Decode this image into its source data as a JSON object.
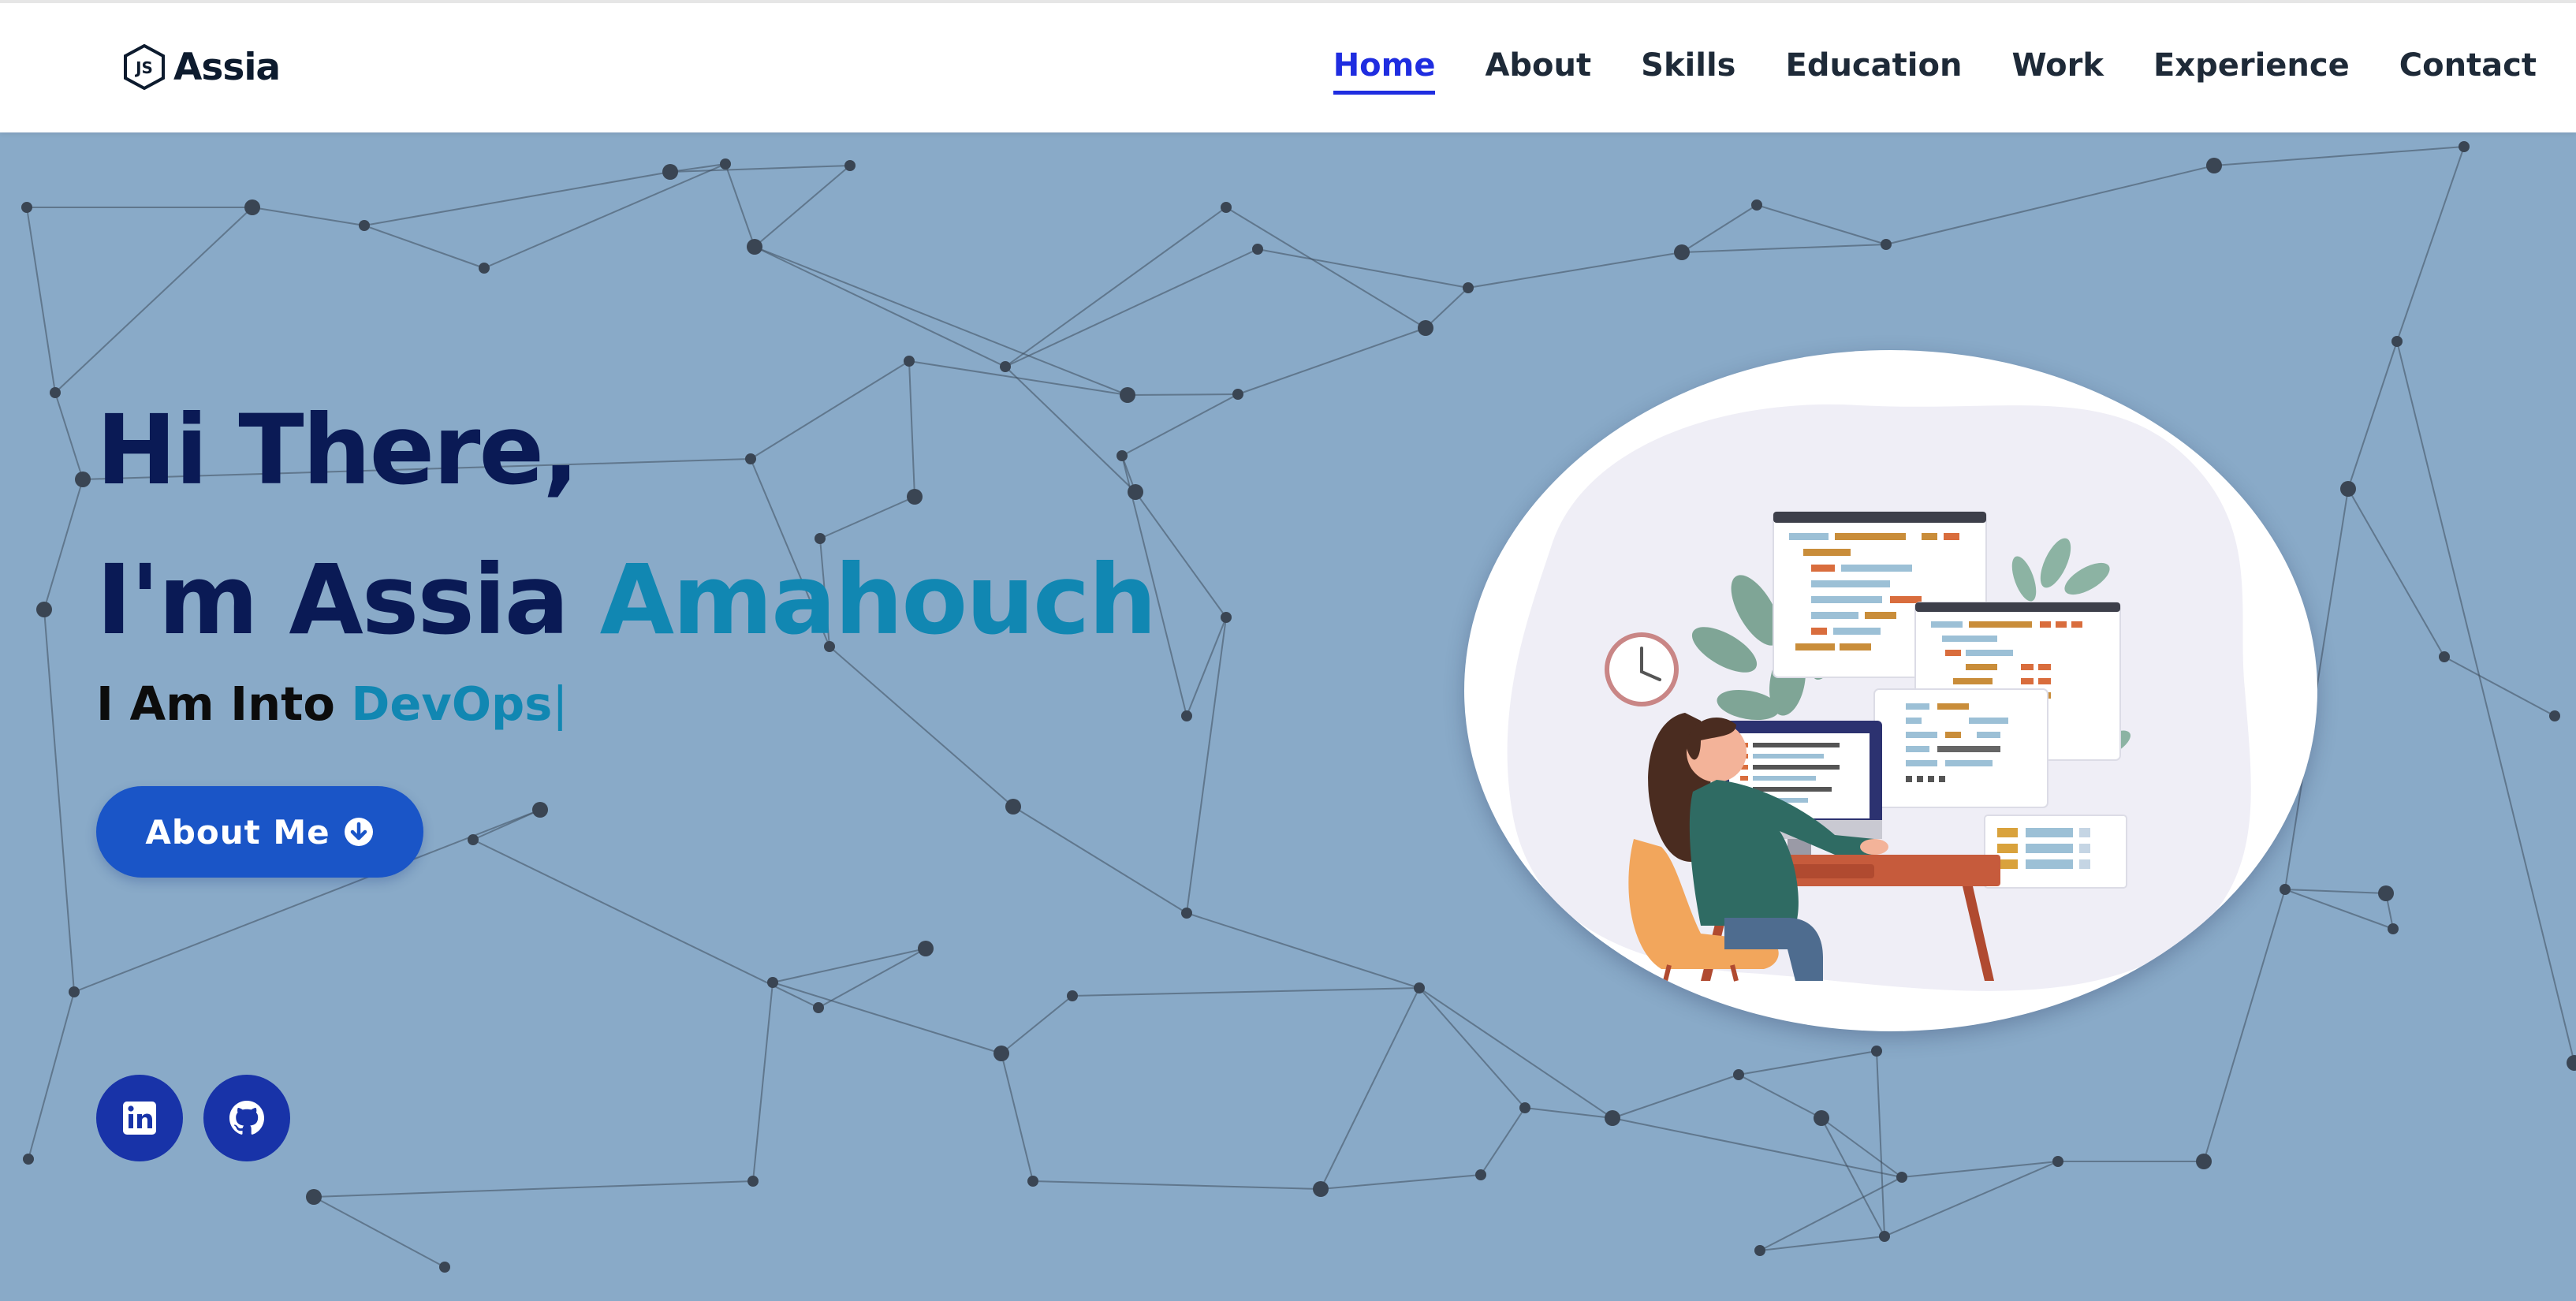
{
  "header": {
    "brand_icon": "nodejs-icon",
    "brand_icon_text": "JS",
    "brand_name": "Assia",
    "nav": [
      {
        "label": "Home",
        "active": true
      },
      {
        "label": "About",
        "active": false
      },
      {
        "label": "Skills",
        "active": false
      },
      {
        "label": "Education",
        "active": false
      },
      {
        "label": "Work",
        "active": false
      },
      {
        "label": "Experience",
        "active": false
      },
      {
        "label": "Contact",
        "active": false
      }
    ]
  },
  "hero": {
    "greeting_line1": "Hi There,",
    "greeting_line2_prefix": "I'm Assia",
    "greeting_line2_accent": "Amahouch",
    "typed_prefix": "I Am Into",
    "typed_value": "DevOps",
    "typed_caret": "|",
    "about_button_label": "About Me",
    "about_button_icon": "arrow-down-circle-icon",
    "social": [
      {
        "name": "linkedin",
        "icon": "linkedin-icon"
      },
      {
        "name": "github",
        "icon": "github-icon"
      }
    ],
    "illustration": "developer-at-desk-illustration"
  },
  "colors": {
    "background": "#89aac8",
    "heading": "#0a1a55",
    "accent": "#1187b2",
    "nav_active": "#1f2de0",
    "button": "#1a55c7",
    "social": "#1833a8"
  }
}
